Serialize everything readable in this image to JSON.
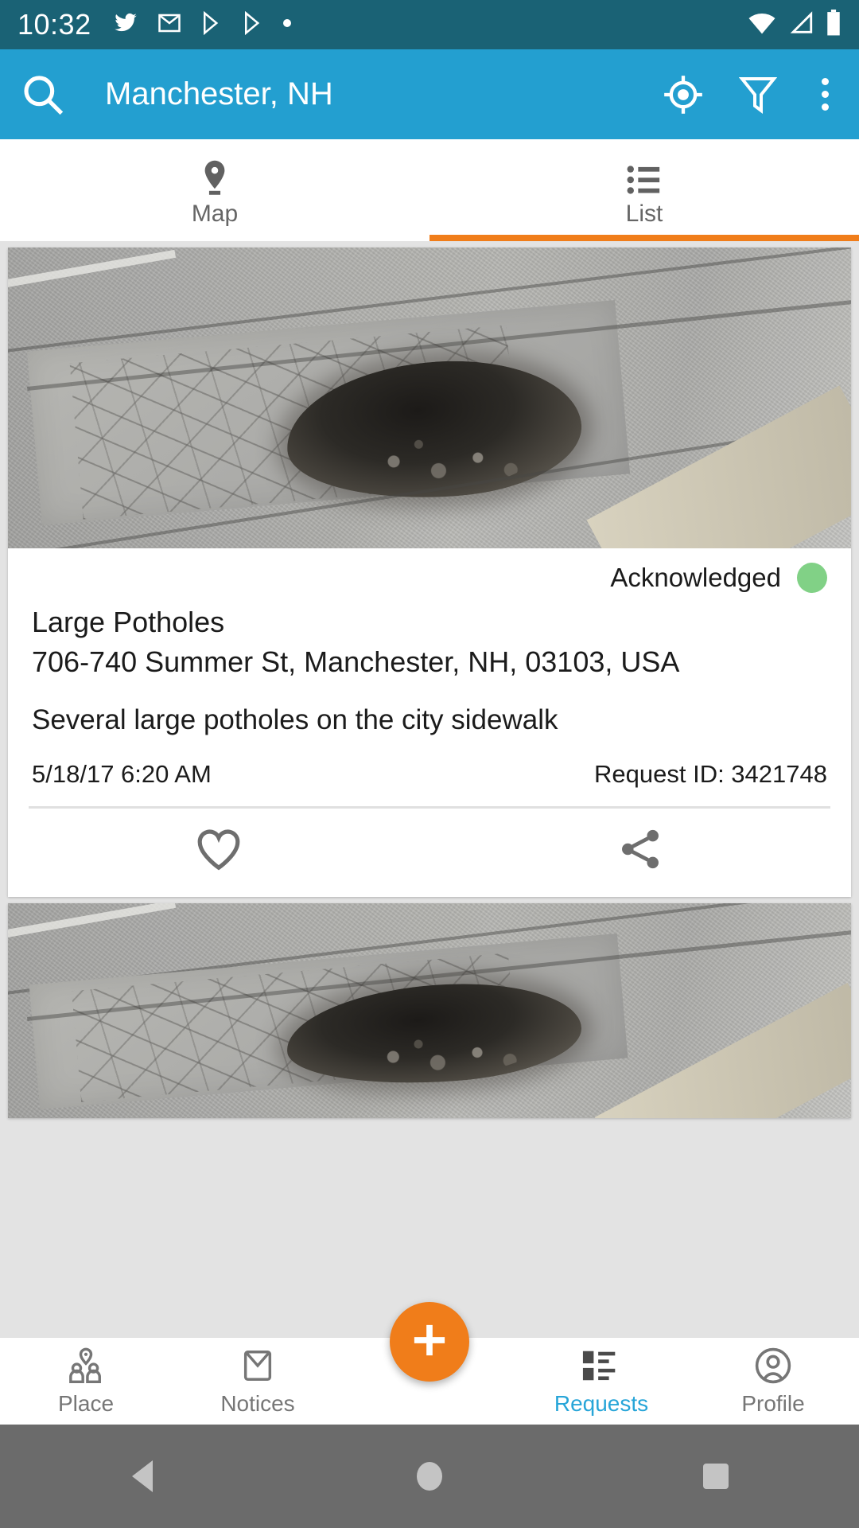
{
  "status_bar": {
    "time": "10:32",
    "left_icons": [
      "twitter-icon",
      "gmail-icon",
      "play-store-icon",
      "play-store-icon-2",
      "dot-icon"
    ],
    "right_icons": [
      "wifi-icon",
      "signal-icon",
      "battery-icon"
    ]
  },
  "app_bar": {
    "search_icon": "search-icon",
    "title": "Manchester, NH",
    "locate_icon": "my-location-icon",
    "filter_icon": "filter-funnel-icon",
    "overflow_icon": "overflow-menu-icon"
  },
  "tabs": {
    "items": [
      {
        "label": "Map",
        "icon": "map-pin-icon",
        "active": false
      },
      {
        "label": "List",
        "icon": "list-bullet-icon",
        "active": true
      }
    ],
    "active_index": 1,
    "indicator_color": "#f07d1a"
  },
  "requests": [
    {
      "photo": "pothole-photo",
      "status_label": "Acknowledged",
      "status_color": "#81d186",
      "title": "Large Potholes",
      "address": "706-740 Summer St, Manchester, NH, 03103, USA",
      "description": "Several large potholes on the city sidewalk",
      "timestamp": "5/18/17 6:20 AM",
      "request_id": "Request ID: 3421748",
      "favorite_icon": "heart-outline-icon",
      "share_icon": "share-icon"
    },
    {
      "photo": "pothole-photo-2"
    }
  ],
  "bottom_nav": {
    "items": [
      {
        "label": "Place",
        "icon": "place-people-icon",
        "active": false
      },
      {
        "label": "Notices",
        "icon": "envelope-icon",
        "active": false
      },
      {
        "label": "Requests",
        "icon": "requests-list-icon",
        "active": true
      },
      {
        "label": "Profile",
        "icon": "person-outline-icon",
        "active": false
      }
    ],
    "fab": {
      "icon": "plus-icon",
      "color": "#f07d1a"
    },
    "active_color": "#27a5d8"
  },
  "system_nav": {
    "back": "back-triangle-icon",
    "home": "home-circle-icon",
    "recents": "recents-square-icon"
  },
  "theme": {
    "status_bar_color": "#1a6275",
    "app_bar_color": "#239fd0",
    "accent_color": "#f07d1a",
    "page_background": "#e3e3e3"
  }
}
